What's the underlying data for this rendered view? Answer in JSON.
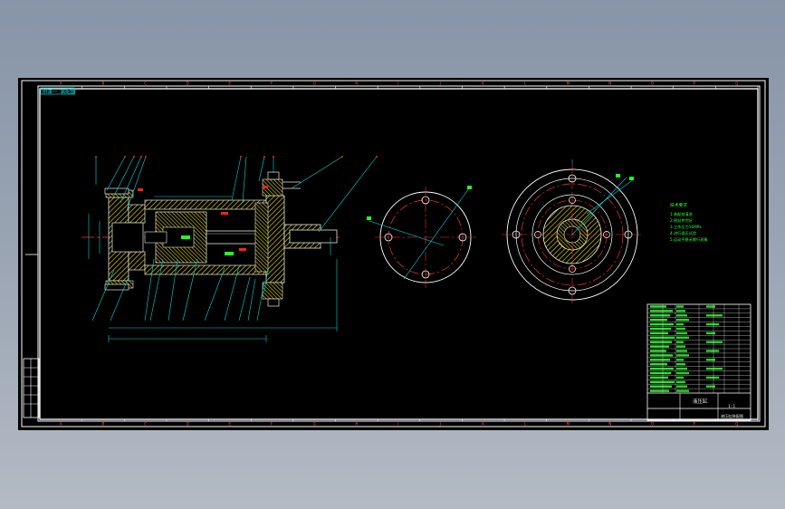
{
  "drawing": {
    "corner_tag": "附录一 装配图",
    "zone_letters_top": [
      "A",
      "B",
      "C",
      "D",
      "E",
      "F",
      "G",
      "H",
      "I",
      "J",
      "K",
      "L",
      "M",
      "N",
      "O",
      "P",
      "Q"
    ],
    "zone_letters_bottom": [
      "A",
      "B",
      "C",
      "D",
      "E",
      "F",
      "G",
      "H",
      "I",
      "J",
      "K",
      "L",
      "M",
      "N",
      "O",
      "P",
      "Q"
    ],
    "tech_requirements": {
      "title": "技术要求",
      "lines": [
        "1.装配前清洗",
        "2.密封件完好",
        "3.工作压力16MPa",
        "4.进行保压试验",
        "5.运动平稳无爬行现象"
      ]
    },
    "title_block": {
      "drawing_name": "液压缸",
      "scale": "1:1",
      "sheet": "液压缸装配图"
    }
  }
}
